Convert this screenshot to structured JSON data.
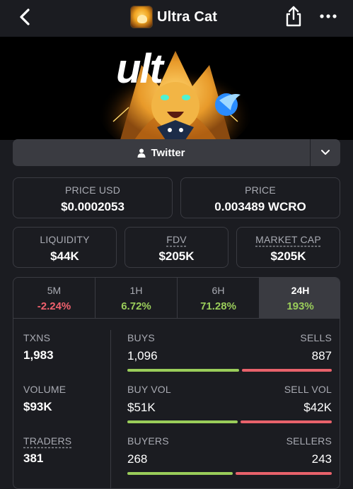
{
  "header": {
    "title": "Ultra Cat",
    "back_icon": "chevron-left-icon",
    "share_icon": "share-icon",
    "more_icon": "more-horizontal-icon"
  },
  "banner": {
    "wordmark": "ult"
  },
  "links": {
    "twitter_label": "Twitter",
    "toggle_icon": "chevron-down-icon"
  },
  "price": {
    "usd_label": "PRICE USD",
    "usd_value": "$0.0002053",
    "native_label": "PRICE",
    "native_value": "0.003489 WCRO"
  },
  "metrics": {
    "liquidity_label": "LIQUIDITY",
    "liquidity_value": "$44K",
    "fdv_label": "FDV",
    "fdv_value": "$205K",
    "mcap_label": "MARKET CAP",
    "mcap_value": "$205K"
  },
  "timeframes": [
    {
      "label": "5M",
      "value": "-2.24%",
      "direction": "down",
      "active": false
    },
    {
      "label": "1H",
      "value": "6.72%",
      "direction": "up",
      "active": false
    },
    {
      "label": "6H",
      "value": "71.28%",
      "direction": "up",
      "active": false
    },
    {
      "label": "24H",
      "value": "193%",
      "direction": "up",
      "active": true
    }
  ],
  "stats": {
    "txns_label": "TXNS",
    "txns_value": "1,983",
    "volume_label": "VOLUME",
    "volume_value": "$93K",
    "traders_label": "TRADERS",
    "traders_value": "381",
    "buys_label": "BUYS",
    "buys_value": "1,096",
    "sells_label": "SELLS",
    "sells_value": "887",
    "buy_share": 0.553,
    "buyvol_label": "BUY VOL",
    "buyvol_value": "$51K",
    "sellvol_label": "SELL VOL",
    "sellvol_value": "$42K",
    "buyvol_share": 0.548,
    "buyers_label": "BUYERS",
    "buyers_value": "268",
    "sellers_label": "SELLERS",
    "sellers_value": "243",
    "buyers_share": 0.524
  },
  "colors": {
    "positive": "#9acd5a",
    "negative": "#f0616d",
    "background": "#1b1c21",
    "panel": "#3a3b41"
  }
}
